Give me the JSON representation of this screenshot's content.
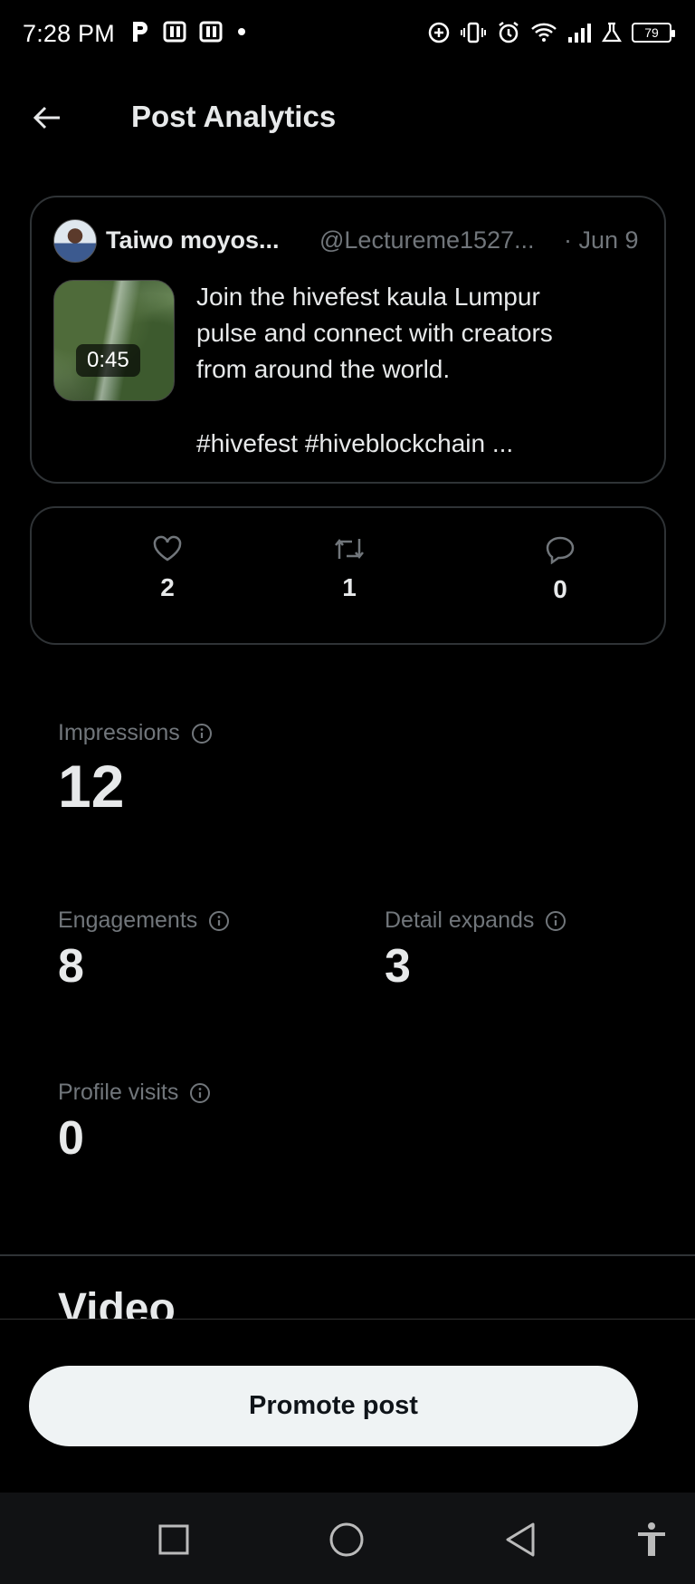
{
  "status_bar": {
    "time": "7:28 PM",
    "left_icons": [
      "parking-icon",
      "document-icon",
      "document-icon",
      "dot-icon"
    ],
    "right_icons": [
      "data-saver-icon",
      "vibrate-icon",
      "alarm-icon",
      "wifi-icon",
      "signal-icon",
      "lab-icon"
    ],
    "battery": "79"
  },
  "header": {
    "title": "Post Analytics",
    "back_icon": "arrow-left-icon"
  },
  "post": {
    "author_name": "Taiwo moyos...",
    "author_handle": "@Lectureme1527...",
    "date": "· Jun 9",
    "video_duration": "0:45",
    "text": "Join the hivefest kaula Lumpur\npulse and connect with creators\nfrom around the world.",
    "tags": "#hivefest #hiveblockchain ..."
  },
  "engagement": {
    "likes": "2",
    "reposts": "1",
    "replies": "0"
  },
  "metrics": {
    "impressions_label": "Impressions",
    "impressions_value": "12",
    "engagements_label": "Engagements",
    "engagements_value": "8",
    "detail_expands_label": "Detail expands",
    "detail_expands_value": "3",
    "profile_visits_label": "Profile visits",
    "profile_visits_value": "0"
  },
  "section": {
    "video_heading": "Video"
  },
  "actions": {
    "promote_label": "Promote post"
  },
  "colors": {
    "background": "#000000",
    "border": "#2f3336",
    "muted_text": "#71767b",
    "primary_text": "#e7e9ea",
    "button_bg": "#eff3f4"
  }
}
